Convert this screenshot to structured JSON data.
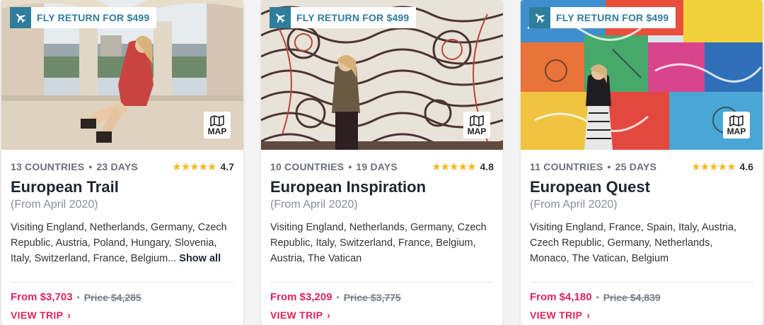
{
  "cards": [
    {
      "badge": "FLY RETURN FOR $499",
      "map_label": "MAP",
      "countries": "13 COUNTRIES",
      "days": "23 DAYS",
      "stars": "★★★★★",
      "rating": "4.7",
      "title": "European Trail",
      "from_date": "(From April 2020)",
      "visiting": "Visiting England, Netherlands, Germany, Czech Republic, Austria, Poland, Hungary, Slovenia, Italy, Switzerland, France, Belgium...",
      "show_all": "Show all",
      "price": "From $3,703",
      "old_price": "Price $4,285",
      "view": "VIEW TRIP"
    },
    {
      "badge": "FLY RETURN FOR $499",
      "map_label": "MAP",
      "countries": "10 COUNTRIES",
      "days": "19 DAYS",
      "stars": "★★★★★",
      "rating": "4.8",
      "title": "European Inspiration",
      "from_date": "(From April 2020)",
      "visiting": "Visiting England, Netherlands, Germany, Czech Republic, Italy, Switzerland, France, Belgium, Austria, The Vatican",
      "price": "From $3,209",
      "old_price": "Price $3,775",
      "view": "VIEW TRIP"
    },
    {
      "badge": "FLY RETURN FOR $499",
      "map_label": "MAP",
      "countries": "11 COUNTRIES",
      "days": "25 DAYS",
      "stars": "★★★★★",
      "rating": "4.6",
      "title": "European Quest",
      "from_date": "(From April 2020)",
      "visiting": "Visiting England, France, Spain, Italy, Austria, Czech Republic, Germany, Netherlands, Monaco, The Vatican, Belgium",
      "price": "From $4,180",
      "old_price": "Price $4,839",
      "view": "VIEW TRIP"
    }
  ],
  "separator": "•",
  "chevron": "›",
  "icons": {
    "plane": "plane-icon",
    "map": "map-icon"
  },
  "colors": {
    "accent": "#e0245e",
    "badge_teal": "#2f7d9d",
    "star": "#f5b81c"
  }
}
